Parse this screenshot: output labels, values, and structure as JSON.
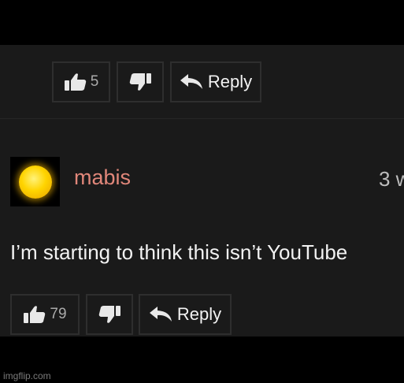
{
  "top_comment": {
    "like_count": "5",
    "reply_label": "Reply"
  },
  "comment": {
    "username": "mabis",
    "timestamp": "3 w",
    "text": "I’m starting to think this isn’t YouTube",
    "like_count": "79",
    "reply_label": "Reply"
  },
  "colors": {
    "background": "#000000",
    "panel": "#1a1a1a",
    "username": "#e1877a",
    "text": "#f2f2f2",
    "avatar": "#ffd400"
  },
  "icons": [
    "thumbs-up-icon",
    "thumbs-down-icon",
    "reply-arrow-icon",
    "sun-avatar"
  ],
  "watermark": "imgflip.com"
}
